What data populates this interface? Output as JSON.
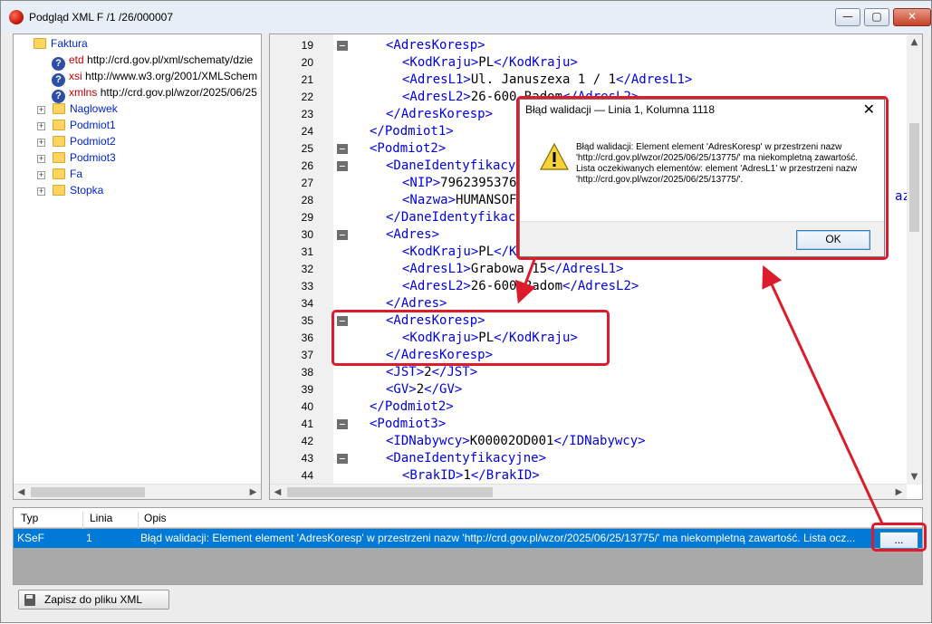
{
  "window": {
    "title": "Podgląd XML F /1  /26/000007",
    "minimize": "—",
    "maximize": "▢",
    "close": "✕"
  },
  "tree": {
    "root": "Faktura",
    "attributes": [
      {
        "name": "etd",
        "value": "http://crd.gov.pl/xml/schematy/dzie"
      },
      {
        "name": "xsi",
        "value": "http://www.w3.org/2001/XMLSchem"
      },
      {
        "name": "xmlns",
        "value": "http://crd.gov.pl/wzor/2025/06/25"
      }
    ],
    "nodes": [
      "Naglowek",
      "Podmiot1",
      "Podmiot2",
      "Podmiot3",
      "Fa",
      "Stopka"
    ]
  },
  "code": {
    "lines": [
      {
        "n": "19",
        "fold": true,
        "indent": 1,
        "text": "<AdresKoresp>"
      },
      {
        "n": "20",
        "fold": false,
        "indent": 2,
        "text": "<KodKraju>PL</KodKraju>"
      },
      {
        "n": "21",
        "fold": false,
        "indent": 2,
        "text": "<AdresL1>Ul. Januszexa 1 / 1</AdresL1>"
      },
      {
        "n": "22",
        "fold": false,
        "indent": 2,
        "text": "<AdresL2>26-600 Radom</AdresL2>"
      },
      {
        "n": "23",
        "fold": false,
        "indent": 1,
        "text": "</AdresKoresp>"
      },
      {
        "n": "24",
        "fold": false,
        "indent": 0,
        "text": "</Podmiot1>"
      },
      {
        "n": "25",
        "fold": true,
        "indent": 0,
        "text": "<Podmiot2>"
      },
      {
        "n": "26",
        "fold": true,
        "indent": 1,
        "text": "<DaneIdentyfikacyjne>"
      },
      {
        "n": "27",
        "fold": false,
        "indent": 2,
        "text": "<NIP>7962395376</NIP>"
      },
      {
        "n": "28",
        "fold": false,
        "indent": 2,
        "text": "<Nazwa>HUMANSOFT</Nazwa>"
      },
      {
        "n": "29",
        "fold": false,
        "indent": 1,
        "text": "</DaneIdentyfikacyjne>"
      },
      {
        "n": "30",
        "fold": true,
        "indent": 1,
        "text": "<Adres>"
      },
      {
        "n": "31",
        "fold": false,
        "indent": 2,
        "text": "<KodKraju>PL</KodKraju>"
      },
      {
        "n": "32",
        "fold": false,
        "indent": 2,
        "text": "<AdresL1>Grabowa 15</AdresL1>"
      },
      {
        "n": "33",
        "fold": false,
        "indent": 2,
        "text": "<AdresL2>26-600 Radom</AdresL2>"
      },
      {
        "n": "34",
        "fold": false,
        "indent": 1,
        "text": "</Adres>"
      },
      {
        "n": "35",
        "fold": true,
        "indent": 1,
        "text": "<AdresKoresp>"
      },
      {
        "n": "36",
        "fold": false,
        "indent": 2,
        "text": "<KodKraju>PL</KodKraju>"
      },
      {
        "n": "37",
        "fold": false,
        "indent": 1,
        "text": "</AdresKoresp>"
      },
      {
        "n": "38",
        "fold": false,
        "indent": 1,
        "text": "<JST>2</JST>"
      },
      {
        "n": "39",
        "fold": false,
        "indent": 1,
        "text": "<GV>2</GV>"
      },
      {
        "n": "40",
        "fold": false,
        "indent": 0,
        "text": "</Podmiot2>"
      },
      {
        "n": "41",
        "fold": true,
        "indent": 0,
        "text": "<Podmiot3>"
      },
      {
        "n": "42",
        "fold": false,
        "indent": 1,
        "text": "<IDNabywcy>K00002OD001</IDNabywcy>"
      },
      {
        "n": "43",
        "fold": true,
        "indent": 1,
        "text": "<DaneIdentyfikacyjne>"
      },
      {
        "n": "44",
        "fold": false,
        "indent": 2,
        "text": "<BrakID>1</BrakID>"
      }
    ],
    "tail_fragment": "azw"
  },
  "results": {
    "columns": [
      "Typ",
      "Linia",
      "Opis"
    ],
    "row": {
      "typ": "KSeF",
      "linia": "1",
      "opis": "Błąd walidacji: Element element 'AdresKoresp' w przestrzeni nazw 'http://crd.gov.pl/wzor/2025/06/25/13775/' ma niekompletną zawartość. Lista ocz...",
      "button": "..."
    }
  },
  "save_button": "Zapisz do pliku XML",
  "dialog": {
    "title": "Błąd walidacji — Linia 1, Kolumna 1118",
    "close": "✕",
    "message": "Błąd walidacji: Element element 'AdresKoresp' w przestrzeni nazw 'http://crd.gov.pl/wzor/2025/06/25/13775/' ma niekompletną zawartość. Lista oczekiwanych elementów: element 'AdresL1' w przestrzeni nazw 'http://crd.gov.pl/wzor/2025/06/25/13775/'.",
    "ok": "OK"
  },
  "colors": {
    "highlight": "#dc1c2c",
    "xml_tag": "#0000e0",
    "selection": "#0079d7"
  }
}
